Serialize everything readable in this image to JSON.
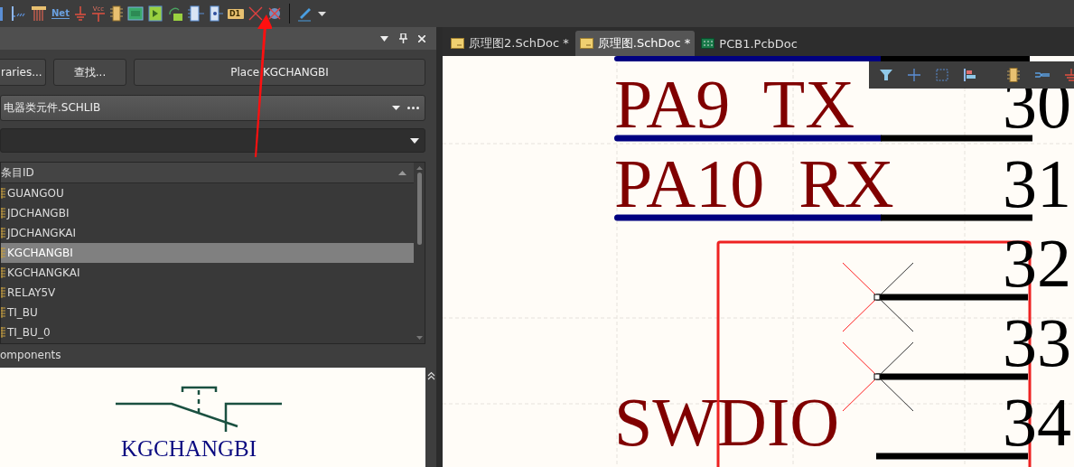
{
  "toolbar": {
    "tools": [
      {
        "kind": "bus"
      },
      {
        "kind": "bus-entry"
      },
      {
        "kind": "harness"
      },
      {
        "kind": "net-label",
        "label": "Net"
      },
      {
        "kind": "ground"
      },
      {
        "kind": "power",
        "label": "Vcc"
      },
      {
        "kind": "part"
      },
      {
        "kind": "sheet"
      },
      {
        "kind": "device-sheet"
      },
      {
        "kind": "refresh-sheet"
      },
      {
        "kind": "sheet-entry"
      },
      {
        "kind": "port"
      },
      {
        "kind": "designator",
        "label": "D1"
      },
      {
        "kind": "no-erc"
      },
      {
        "kind": "no-erc-blue"
      },
      {
        "kind": "separator"
      },
      {
        "kind": "pen"
      },
      {
        "kind": "caret"
      }
    ]
  },
  "panel": {
    "buttons": [
      "raries...",
      "查找...",
      "Place KGCHANGBI"
    ],
    "library": "电器类元件.SCHLIB",
    "list": {
      "column": "条目ID",
      "items": [
        {
          "name": "GUANGOU",
          "selected": false
        },
        {
          "name": "JDCHANGBI",
          "selected": false
        },
        {
          "name": "JDCHANGKAI",
          "selected": false
        },
        {
          "name": "KGCHANGBI",
          "selected": true
        },
        {
          "name": "KGCHANGKAI",
          "selected": false
        },
        {
          "name": "RELAY5V",
          "selected": false
        },
        {
          "name": "TI_BU",
          "selected": false
        },
        {
          "name": "TI_BU_0",
          "selected": false
        }
      ]
    },
    "section_label": "omponents",
    "preview": {
      "name": "KGCHANGBI"
    }
  },
  "tabs": [
    {
      "label": "原理图2.SchDoc *",
      "kind": "schematic",
      "selected": false
    },
    {
      "label": "原理图.SchDoc *",
      "kind": "schematic",
      "selected": true
    },
    {
      "label": "PCB1.PcbDoc",
      "kind": "pcb",
      "selected": false
    }
  ],
  "canvas": {
    "pins": [
      {
        "label": "PA9  TX",
        "number": "30",
        "wired": true,
        "no_connect": false
      },
      {
        "label": "PA10  RX",
        "number": "31",
        "wired": true,
        "no_connect": false
      },
      {
        "number": "32",
        "wired": false,
        "no_connect": true
      },
      {
        "number": "33",
        "wired": false,
        "no_connect": true
      },
      {
        "label": "SWDIO",
        "number": "34",
        "wired": false,
        "no_connect": false
      }
    ]
  }
}
